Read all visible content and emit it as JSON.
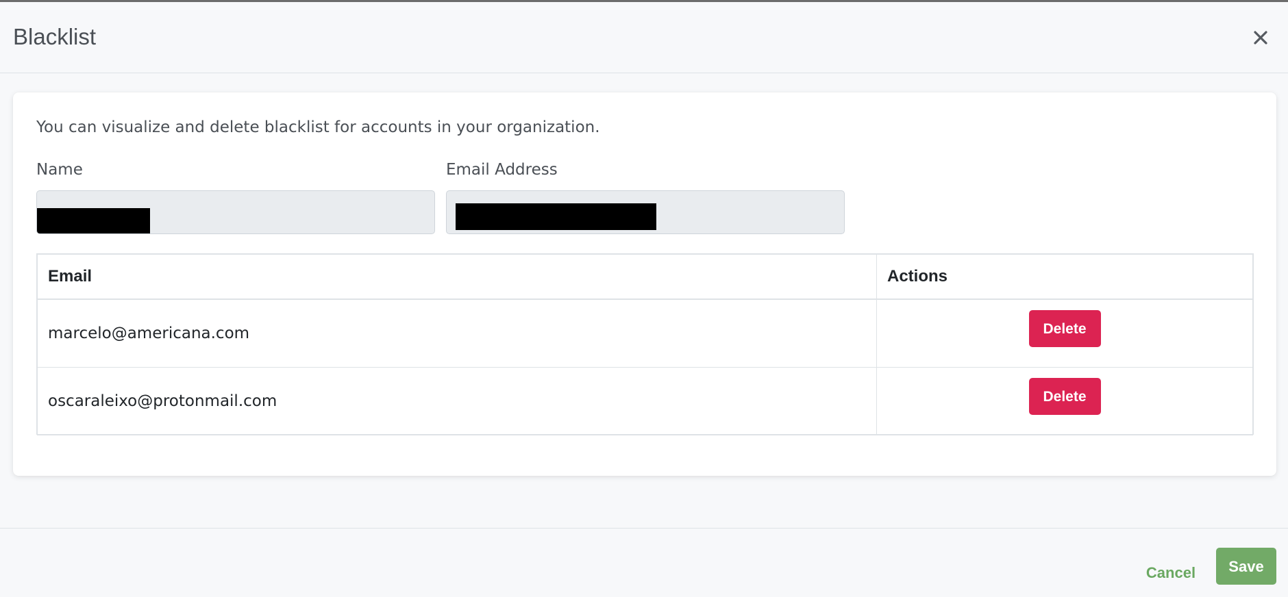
{
  "modal": {
    "title": "Blacklist",
    "description": "You can visualize and delete blacklist for accounts in your organization."
  },
  "fields": {
    "name_label": "Name",
    "email_label": "Email Address"
  },
  "table": {
    "headers": [
      "Email",
      "Actions"
    ],
    "rows": [
      {
        "email": "marcelo@americana.com",
        "action": "Delete"
      },
      {
        "email": "oscaraleixo@protonmail.com",
        "action": "Delete"
      }
    ]
  },
  "footer": {
    "cancel_label": "Cancel",
    "save_label": "Save"
  },
  "icons": {
    "close": "close-icon"
  },
  "colors": {
    "delete": "#dc2352",
    "primary": "#72aa67",
    "link": "#6aa861"
  }
}
